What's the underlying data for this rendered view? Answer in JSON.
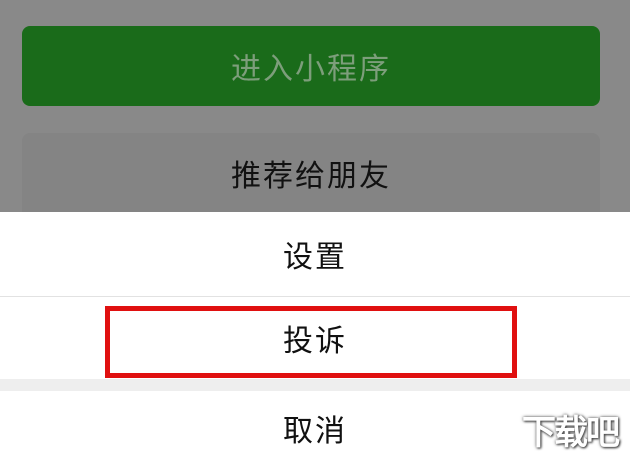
{
  "background_page": {
    "enter_miniprogram_label": "进入小程序",
    "recommend_to_friend_label": "推荐给朋友"
  },
  "action_sheet": {
    "settings_label": "设置",
    "report_label": "投诉",
    "cancel_label": "取消"
  },
  "annotation": {
    "highlight_color": "#e01010"
  },
  "watermark": {
    "text": "下载吧"
  },
  "colors": {
    "enter_button": "#1a6b1a",
    "overlay": "#898989",
    "sheet_bg": "#ffffff"
  }
}
